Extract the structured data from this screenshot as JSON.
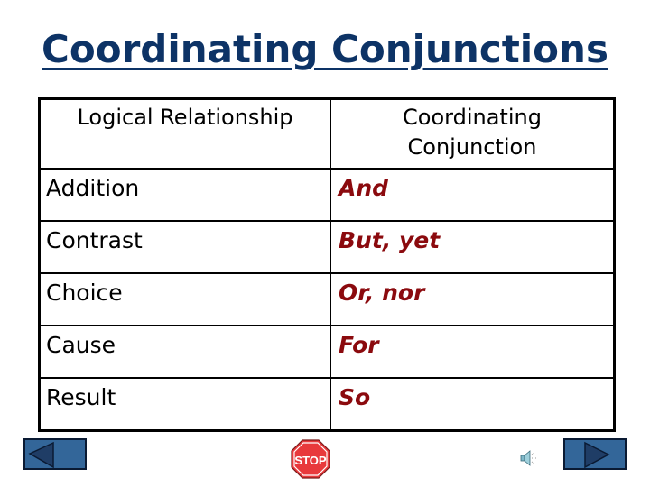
{
  "title": "Coordinating Conjunctions",
  "table": {
    "headers": [
      "Logical Relationship",
      "Coordinating Conjunction"
    ],
    "rows": [
      {
        "relationship": "Addition",
        "conjunction": "And"
      },
      {
        "relationship": "Contrast",
        "conjunction": "But, yet"
      },
      {
        "relationship": "Choice",
        "conjunction": "Or, nor"
      },
      {
        "relationship": "Cause",
        "conjunction": "For"
      },
      {
        "relationship": "Result",
        "conjunction": "So"
      }
    ]
  },
  "controls": {
    "previous_icon": "triangle-left-icon",
    "stop_label": "STOP",
    "speaker_icon": "speaker-icon",
    "next_icon": "triangle-right-icon"
  },
  "colors": {
    "title": "#0d3366",
    "conjunction_text": "#8b0a0e",
    "nav_button": "#336699",
    "stop_sign": "#e8393c"
  }
}
